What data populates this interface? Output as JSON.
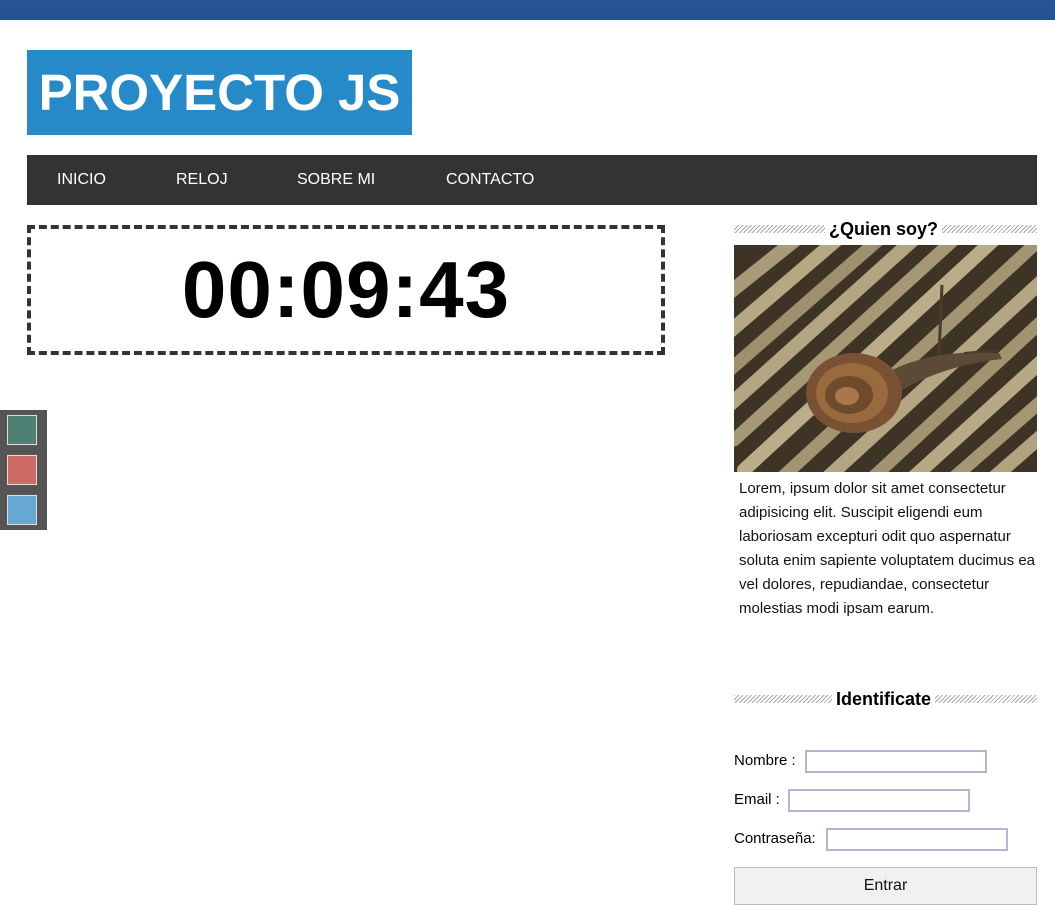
{
  "header": {
    "logo_text": "PROYECTO JS"
  },
  "nav": {
    "items": [
      {
        "label": "INICIO"
      },
      {
        "label": "RELOJ"
      },
      {
        "label": "SOBRE MI"
      },
      {
        "label": "CONTACTO"
      }
    ]
  },
  "clock": {
    "time": "00:09:43"
  },
  "theme_swatches": {
    "colors": [
      "#4e8173",
      "#cd6a65",
      "#66a7d4"
    ]
  },
  "sidebar": {
    "about_title": "¿Quien soy?",
    "about_text": "Lorem, ipsum dolor sit amet consectetur adipisicing elit. Suscipit eligendi eum laboriosam excepturi odit quo aspernatur soluta enim sapiente voluptatem ducimus ea vel dolores, repudiandae, consectetur molestias modi ipsam earum.",
    "login_title": "Identificate",
    "form": {
      "name_label": "Nombre :",
      "email_label": "Email :",
      "password_label": "Contraseña:",
      "name_value": "",
      "email_value": "",
      "password_value": "",
      "submit_label": "Entrar"
    }
  },
  "colors": {
    "topbar": "#2a5597",
    "logo_bg": "#268ac8",
    "nav_bg": "#333333",
    "swatch_panel": "#555555"
  }
}
